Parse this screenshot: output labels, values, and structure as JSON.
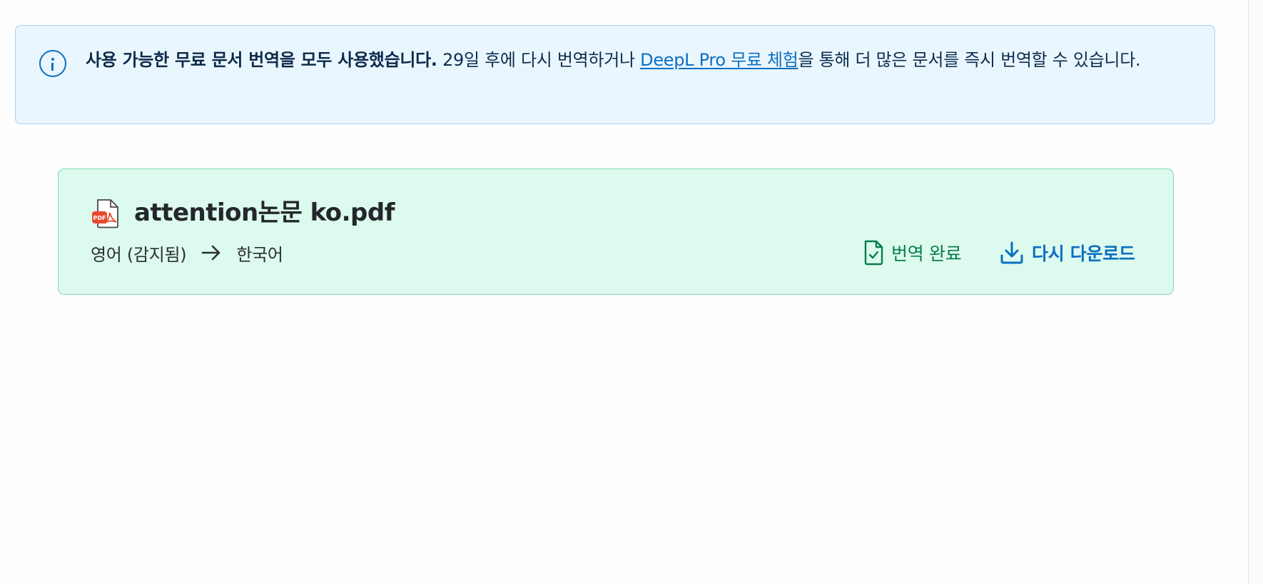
{
  "banner": {
    "strong_text": "사용 가능한 무료 문서 번역을 모두 사용했습니다.",
    "text_before_link": " 29일 후에 다시 번역하거나 ",
    "link_text": "DeepL Pro 무료 체험",
    "text_after_link": "을 통해 더 많은 문서를 즉시 번역할 수 있습니다.",
    "icon": "info-icon"
  },
  "document": {
    "file_name": "attention논문 ko.pdf",
    "file_icon": "pdf-file-icon",
    "pdf_badge": "PDF",
    "source_language": "영어 (감지됨)",
    "target_language": "한국어",
    "status_label": "번역 완료",
    "download_label": "다시 다운로드"
  },
  "colors": {
    "banner_bg": "#eaf6fe",
    "banner_border": "#a9d2ec",
    "accent_blue": "#0b6fc2",
    "card_bg": "#dcfaed",
    "card_border": "#82d9b6",
    "success_green": "#087c4e",
    "pdf_red": "#e8492f"
  }
}
